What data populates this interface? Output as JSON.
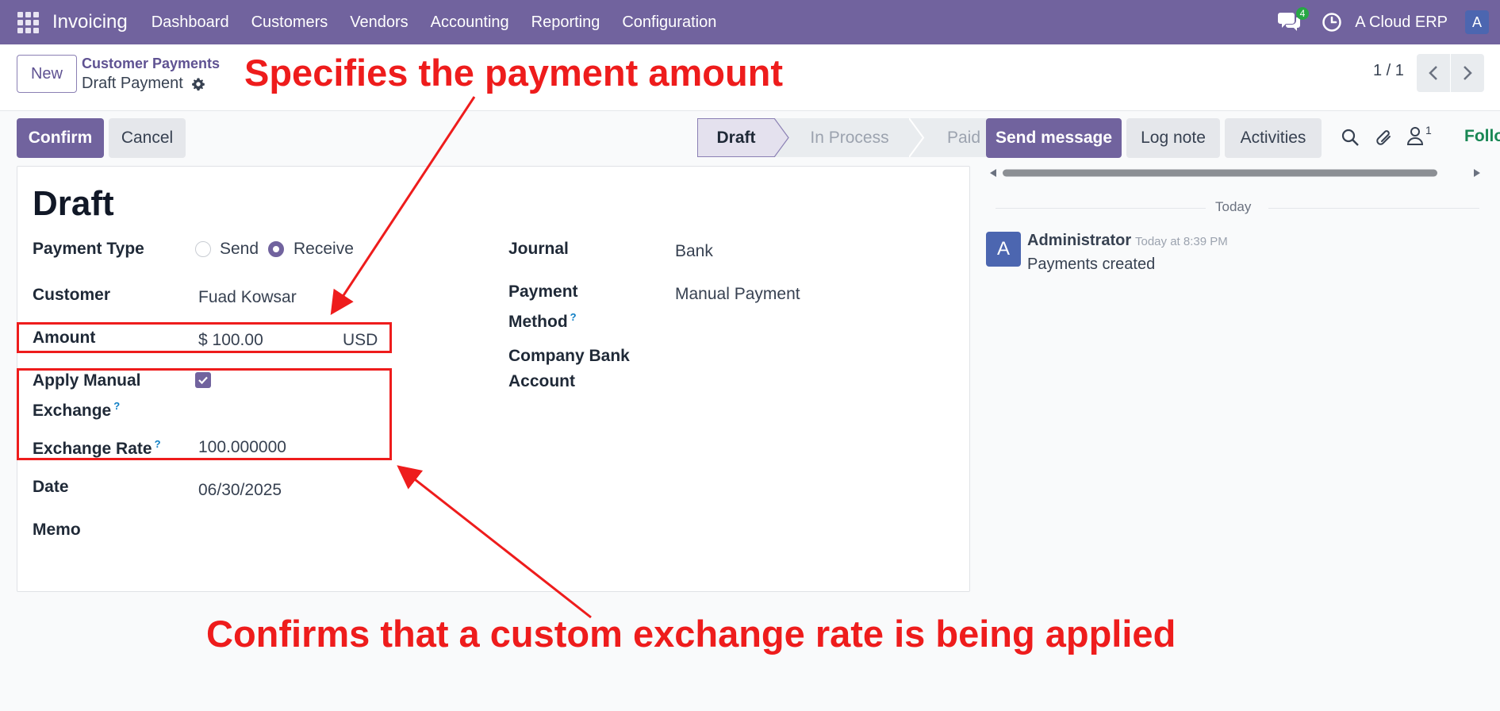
{
  "navbar": {
    "app_name": "Invoicing",
    "menu": [
      "Dashboard",
      "Customers",
      "Vendors",
      "Accounting",
      "Reporting",
      "Configuration"
    ],
    "messages_badge": "4",
    "company": "A Cloud ERP",
    "user_initial": "A",
    "bar_color": "#71639e"
  },
  "control_panel": {
    "new_label": "New",
    "breadcrumb_parent": "Customer Payments",
    "breadcrumb_current": "Draft Payment",
    "pager": "1 / 1"
  },
  "actions": {
    "confirm": "Confirm",
    "cancel": "Cancel"
  },
  "statusbar": {
    "stages": [
      "Draft",
      "In Process",
      "Paid"
    ],
    "active": "Draft"
  },
  "form": {
    "title": "Draft",
    "payment_type": {
      "label": "Payment Type",
      "options": [
        "Send",
        "Receive"
      ],
      "selected": "Receive"
    },
    "customer": {
      "label": "Customer",
      "value": "Fuad Kowsar"
    },
    "amount": {
      "label": "Amount",
      "value": "$ 100.00",
      "currency": "USD"
    },
    "apply_manual_exchange": {
      "label_line1": "Apply Manual",
      "label_line2": "Exchange",
      "help": "?",
      "checked": true
    },
    "exchange_rate": {
      "label": "Exchange Rate",
      "help": "?",
      "value": "100.000000"
    },
    "date": {
      "label": "Date",
      "value": "06/30/2025"
    },
    "memo": {
      "label": "Memo",
      "value": ""
    },
    "journal": {
      "label": "Journal",
      "value": "Bank"
    },
    "payment_method": {
      "label_line1": "Payment",
      "label_line2": "Method",
      "help": "?",
      "value": "Manual Payment"
    },
    "company_bank_account": {
      "label_line1": "Company Bank",
      "label_line2": "Account",
      "value": ""
    }
  },
  "annotations": {
    "top": "Specifies the payment amount",
    "bottom": "Confirms that a custom exchange rate is being applied",
    "color": "#ee1c1c"
  },
  "chatter": {
    "send_message": "Send message",
    "log_note": "Log note",
    "activities": "Activities",
    "followers_count": "1",
    "follow": "Follow",
    "date_separator": "Today",
    "message": {
      "avatar": "A",
      "author": "Administrator",
      "time": "Today at 8:39 PM",
      "body": "Payments created"
    }
  }
}
